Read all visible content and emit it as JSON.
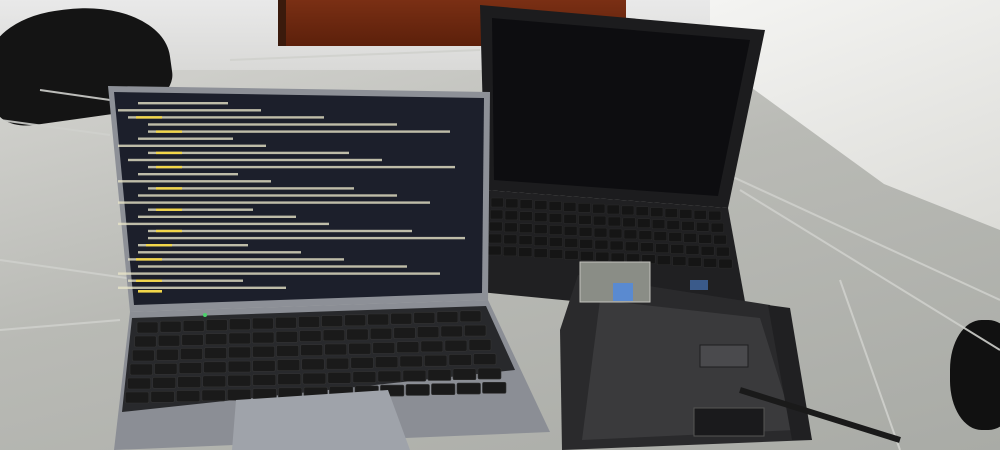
{
  "scene": {
    "colors": {
      "terminal_bg": "#1c1f2b",
      "terminal_text": "#e7e4c8",
      "terminal_highlight": "#f2d64a",
      "laptop_silver": "#8d9097",
      "laptop_black": "#1b1b1d",
      "floor_tile": "#bdbeba",
      "door_wood": "#6a2711"
    },
    "terminal_lines": [
      {
        "indent": 2,
        "color": "#e7e4c8",
        "hl": false
      },
      {
        "indent": 0,
        "color": "#e7e4c8",
        "hl": false
      },
      {
        "indent": 1,
        "color": "#e7e4c8",
        "hl": true
      },
      {
        "indent": 3,
        "color": "#e7e4c8",
        "hl": false
      },
      {
        "indent": 3,
        "color": "#e7e4c8",
        "hl": true
      },
      {
        "indent": 2,
        "color": "#e7e4c8",
        "hl": false
      },
      {
        "indent": 0,
        "color": "#e7e4c8",
        "hl": false
      },
      {
        "indent": 3,
        "color": "#e7e4c8",
        "hl": true
      },
      {
        "indent": 1,
        "color": "#e7e4c8",
        "hl": false
      },
      {
        "indent": 3,
        "color": "#e7e4c8",
        "hl": true
      },
      {
        "indent": 2,
        "color": "#e7e4c8",
        "hl": false
      },
      {
        "indent": 0,
        "color": "#e7e4c8",
        "hl": false
      },
      {
        "indent": 3,
        "color": "#e7e4c8",
        "hl": true
      },
      {
        "indent": 2,
        "color": "#e7e4c8",
        "hl": false
      },
      {
        "indent": 0,
        "color": "#e7e4c8",
        "hl": false
      },
      {
        "indent": 3,
        "color": "#e7e4c8",
        "hl": true
      },
      {
        "indent": 2,
        "color": "#e7e4c8",
        "hl": false
      },
      {
        "indent": 0,
        "color": "#e7e4c8",
        "hl": false
      },
      {
        "indent": 3,
        "color": "#e7e4c8",
        "hl": true
      },
      {
        "indent": 3,
        "color": "#e7e4c8",
        "hl": false
      },
      {
        "indent": 2,
        "color": "#e7e4c8",
        "hl": true
      },
      {
        "indent": 2,
        "color": "#e7e4c8",
        "hl": false
      },
      {
        "indent": 1,
        "color": "#e7e4c8",
        "hl": true
      },
      {
        "indent": 2,
        "color": "#e7e4c8",
        "hl": false
      },
      {
        "indent": 0,
        "color": "#e7e4c8",
        "hl": false
      },
      {
        "indent": 1,
        "color": "#e7e4c8",
        "hl": true
      },
      {
        "indent": 0,
        "color": "#e7e4c8",
        "hl": false
      }
    ],
    "objects": [
      "silver-laptop",
      "black-laptop",
      "disassembled-laptop-chassis",
      "black-shoes",
      "wooden-door",
      "tiled-floor"
    ]
  }
}
